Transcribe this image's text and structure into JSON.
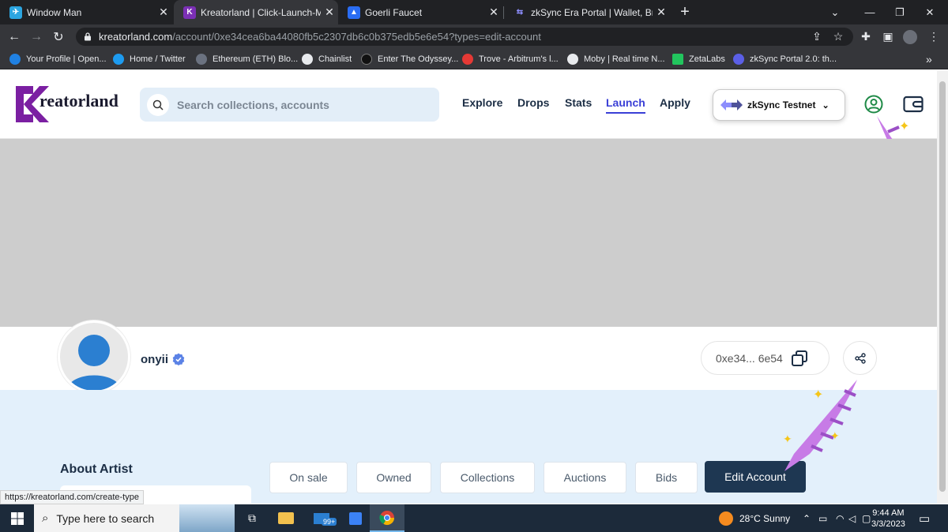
{
  "browser": {
    "tabs": [
      {
        "title": "Window Man",
        "color": "#2ca5e0"
      },
      {
        "title": "Kreatorland | Click-Launch-Mint N",
        "color": "#7b2fb5",
        "active": true
      },
      {
        "title": "Goerli Faucet",
        "color": "#2a6df4"
      },
      {
        "title": "zkSync Era Portal | Wallet, Bridge",
        "color": "#5b5fe6"
      }
    ],
    "new_tab": "+",
    "url_host": "kreatorland.com",
    "url_path": "/account/0xe34cea6ba44080fb5c2307db6c0b375edb5e6e54?types=edit-account",
    "bookmarks": [
      {
        "label": "Your Profile | Open...",
        "color": "#2081e2"
      },
      {
        "label": "Home / Twitter",
        "color": "#1d9bf0"
      },
      {
        "label": "Ethereum (ETH) Blo...",
        "color": "#6b7280"
      },
      {
        "label": "Chainlist",
        "color": "#e8eaed"
      },
      {
        "label": "Enter The Odyssey...",
        "color": "#111111"
      },
      {
        "label": "Trove - Arbitrum's l...",
        "color": "#e53935"
      },
      {
        "label": "Moby | Real time N...",
        "color": "#e8eaed"
      },
      {
        "label": "ZetaLabs",
        "color": "#22c55e"
      },
      {
        "label": "zkSync Portal 2.0: th...",
        "color": "#5b5fe6"
      }
    ]
  },
  "site": {
    "logo_text": "reatorland",
    "search_placeholder": "Search collections, accounts",
    "nav": [
      "Explore",
      "Drops",
      "Stats",
      "Launch",
      "Apply"
    ],
    "active_nav": "Launch",
    "network": "zkSync Testnet",
    "accent": "#3a3fd6"
  },
  "profile": {
    "username": "onyii",
    "address": "0xe34... 6e54",
    "about_heading": "About Artist"
  },
  "filter_tabs": [
    "On sale",
    "Owned",
    "Collections",
    "Auctions",
    "Bids"
  ],
  "edit_button": "Edit Account",
  "status_url": "https://kreatorland.com/create-type",
  "taskbar": {
    "search_placeholder": "Type here to search",
    "mail_badge": "99+",
    "weather": "28°C  Sunny",
    "time": "9:44 AM",
    "date": "3/3/2023"
  }
}
